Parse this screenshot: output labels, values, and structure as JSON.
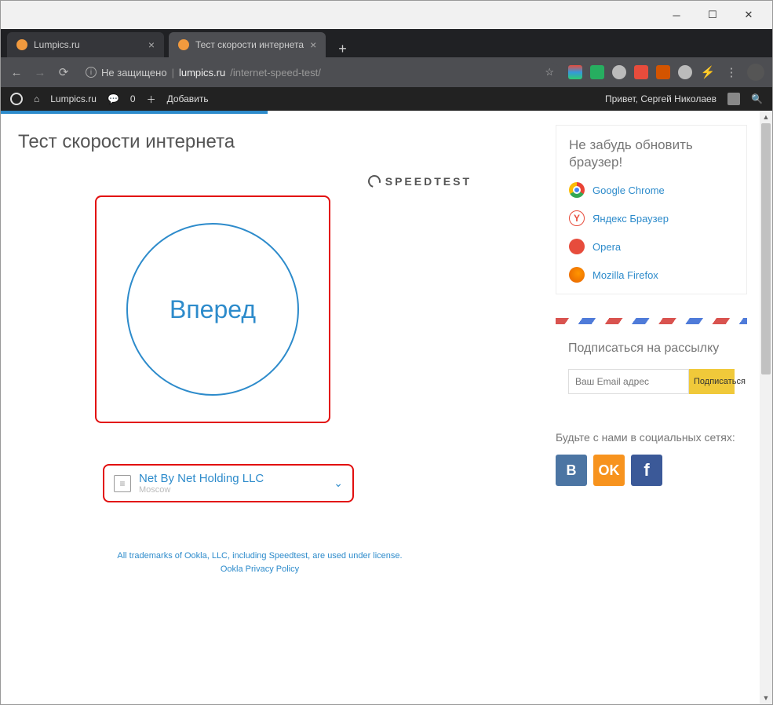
{
  "tabs": [
    {
      "title": "Lumpics.ru"
    },
    {
      "title": "Тест скорости интернета"
    }
  ],
  "addressbar": {
    "secure_label": "Не защищено",
    "host": "lumpics.ru",
    "path": "/internet-speed-test/"
  },
  "wpbar": {
    "site": "Lumpics.ru",
    "comments": "0",
    "add": "Добавить",
    "greeting": "Привет, Сергей Николаев"
  },
  "page": {
    "title": "Тест скорости интернета",
    "speedtest_brand": "SPEEDTEST",
    "go_label": "Вперед",
    "server": {
      "name": "Net By Net Holding LLC",
      "city": "Moscow"
    },
    "trademark_line1": "All trademarks of Ookla, LLC, including Speedtest, are used under license.",
    "trademark_line2": "Ookla Privacy Policy"
  },
  "sidebar": {
    "update_title": "Не забудь обновить браузер!",
    "browsers": {
      "chrome": "Google Chrome",
      "yandex": "Яндекс Браузер",
      "opera": "Opera",
      "firefox": "Mozilla Firefox"
    },
    "subscribe_title": "Подписаться на рассылку",
    "email_placeholder": "Ваш Email адрес",
    "subscribe_btn": "Подписаться",
    "social_title": "Будьте с нами в социальных сетях:"
  }
}
